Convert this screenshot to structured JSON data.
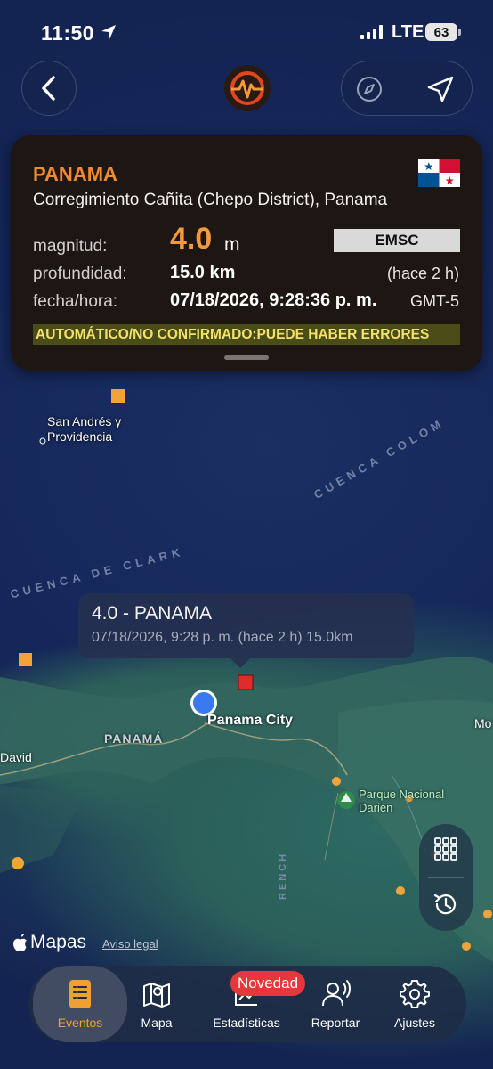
{
  "status_bar": {
    "time": "11:50",
    "network": "LTE",
    "battery": "63"
  },
  "event": {
    "title": "PANAMA",
    "region": "Corregimiento Cañita (Chepo District), Panama",
    "labels": {
      "magnitude": "magnitud:",
      "depth": "profundidad:",
      "datetime": "fecha/hora:"
    },
    "magnitude": "4.0",
    "magnitude_unit": "m",
    "source": "EMSC",
    "depth": "15.0 km",
    "ago": "(hace 2 h)",
    "datetime": "07/18/2026, 9:28:36 p. m.",
    "timezone": "GMT-5",
    "warning": "AUTOMÁTICO/NO CONFIRMADO:PUEDE HABER ERRORES"
  },
  "tooltip": {
    "title": "4.0 - PANAMA",
    "subtitle": "07/18/2026, 9:28 p. m. (hace 2 h) 15.0km"
  },
  "map_labels": {
    "san_andres": "San Andrés y",
    "providencia": "Providencia",
    "panama_city": "Panama City",
    "panama": "PANAMÁ",
    "david": "David",
    "parque": "Parque Nacional",
    "darien": "Darién",
    "mo": "Mo",
    "cuenca_clark": "CUENCA DE CLARK",
    "cuenca_colombia": "CUENCA COLOM",
    "trench": "RENCH"
  },
  "attribution": {
    "maps": "Mapas",
    "legal": "Aviso legal"
  },
  "tabs": [
    {
      "label": "Eventos",
      "icon": "list-icon",
      "active": true
    },
    {
      "label": "Mapa",
      "icon": "map-icon",
      "active": false
    },
    {
      "label": "Estadísticas",
      "icon": "stats-icon",
      "active": false
    },
    {
      "label": "Reportar",
      "icon": "report-icon",
      "active": false
    },
    {
      "label": "Ajustes",
      "icon": "gear-icon",
      "active": false
    }
  ],
  "badge": "Novedad",
  "colors": {
    "accent": "#f08a2a",
    "marker_main": "#e02b2b",
    "marker_other": "#f2a33a",
    "user_location": "#3a7af0"
  }
}
